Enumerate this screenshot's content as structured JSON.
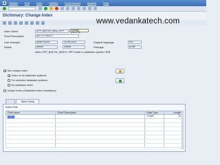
{
  "menu": {
    "items": [
      "Utilities",
      "Edit",
      "Goto",
      "Utilities",
      "Environment",
      "System",
      "Help"
    ]
  },
  "title": "Dictionary: Change Index",
  "watermark": "www.vedankatech.com",
  "form": {
    "index_name_label": "Index Name",
    "index_name_value": "ZPP_BATCH_INDEX",
    "index_name_suffix": "ZPP",
    "index_status_text": "Activate",
    "index_status_shortcut": "(Ctrl+F3)",
    "short_desc_label": "Short Description",
    "short_desc_value": "BATCH INDEX",
    "last_changed_label": "Last changed",
    "last_changed_user": "ABAPUSER",
    "last_changed_date": "10.06.2024",
    "orig_lang_label": "Original language",
    "orig_lang_value": "EN",
    "status_label": "Status",
    "status_value": "Active",
    "status_saved": "Saved",
    "package_label": "Package",
    "package_value": "$TMP",
    "info_text": "Index ZPP_BATCH_INDEX~ZPP exists in database system HDB"
  },
  "options": {
    "non_unique": "Non-unique index",
    "all_db": "Index on all database systems",
    "selected_db": "For selected database systems",
    "no_db": "No database index",
    "unique": "Unique index (Database index mandatory)"
  },
  "tabs": [
    "",
    "Table Fields"
  ],
  "panel": {
    "title": "Index Flds",
    "columns": [
      "Field name",
      "Short Description",
      "Data Type",
      "Length"
    ],
    "rows": [
      {
        "field": "ZZIS",
        "desc": "",
        "type": "CHAR",
        "length": "10"
      }
    ]
  }
}
